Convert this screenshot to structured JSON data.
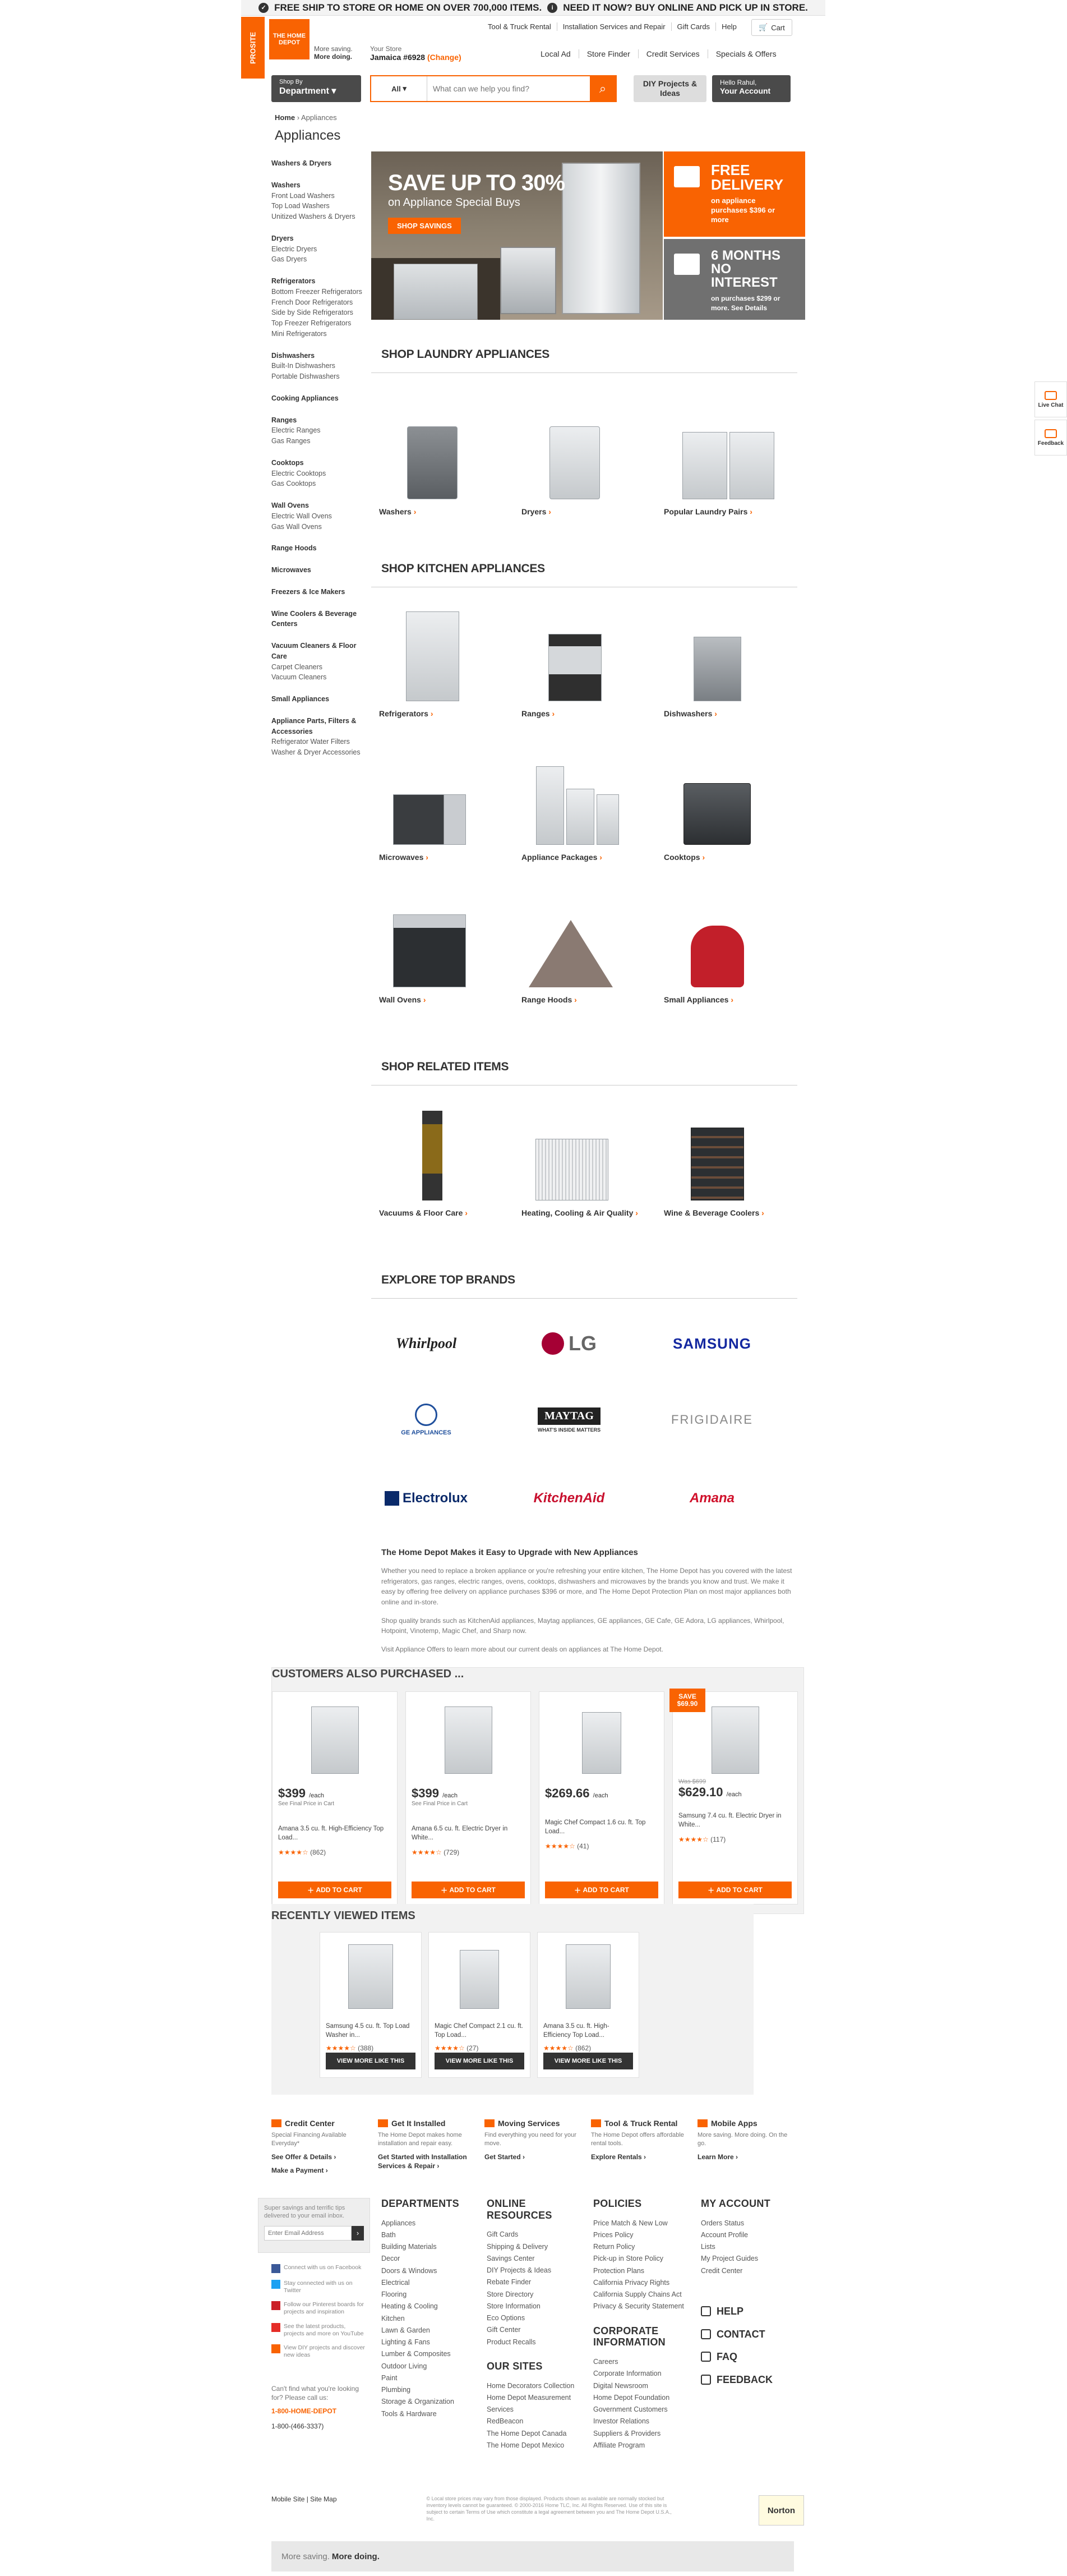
{
  "banner": {
    "left": "FREE SHIP TO STORE OR HOME ON OVER 700,000 ITEMS.",
    "right": "NEED IT NOW? BUY ONLINE AND PICK UP IN STORE."
  },
  "header": {
    "prosite": "PROSITE",
    "logo": "THE HOME DEPOT",
    "tagline1": "More saving.",
    "tagline2": "More doing.",
    "toplinks": [
      "Tool & Truck Rental",
      "Installation Services and Repair",
      "Gift Cards",
      "Help"
    ],
    "cart": "Cart",
    "store_label": "Your Store",
    "store_name": "Jamaica #6928",
    "store_change": "(Change)",
    "mainlinks": [
      "Local Ad",
      "Store Finder",
      "Credit Services",
      "Specials & Offers"
    ],
    "dept_top": "Shop By",
    "dept_bottom": "Department",
    "search_all": "All",
    "search_placeholder": "What can we help you find?",
    "diy": "DIY Projects & Ideas",
    "acct_top": "Hello Rahul,",
    "acct_bottom": "Your Account"
  },
  "breadcrumb": {
    "home": "Home",
    "current": "Appliances"
  },
  "page_title": "Appliances",
  "sidebar": [
    {
      "h": "Washers & Dryers",
      "items": []
    },
    {
      "h": "Washers",
      "items": [
        "Front Load Washers",
        "Top Load Washers",
        "Unitized Washers & Dryers"
      ]
    },
    {
      "h": "Dryers",
      "items": [
        "Electric Dryers",
        "Gas Dryers"
      ]
    },
    {
      "h": "Refrigerators",
      "items": [
        "Bottom Freezer Refrigerators",
        "French Door Refrigerators",
        "Side by Side Refrigerators",
        "Top Freezer Refrigerators",
        "Mini Refrigerators"
      ]
    },
    {
      "h": "Dishwashers",
      "items": [
        "Built-In Dishwashers",
        "Portable Dishwashers"
      ]
    },
    {
      "h": "Cooking Appliances",
      "items": []
    },
    {
      "h": "Ranges",
      "items": [
        "Electric Ranges",
        "Gas Ranges"
      ]
    },
    {
      "h": "Cooktops",
      "items": [
        "Electric Cooktops",
        "Gas Cooktops"
      ]
    },
    {
      "h": "Wall Ovens",
      "items": [
        "Electric Wall Ovens",
        "Gas Wall Ovens"
      ]
    },
    {
      "h": "Range Hoods",
      "items": []
    },
    {
      "h": "Microwaves",
      "items": []
    },
    {
      "h": "Freezers & Ice Makers",
      "items": []
    },
    {
      "h": "Wine Coolers & Beverage Centers",
      "items": []
    },
    {
      "h": "Vacuum Cleaners & Floor Care",
      "items": [
        "Carpet Cleaners",
        "Vacuum Cleaners"
      ]
    },
    {
      "h": "Small Appliances",
      "items": []
    },
    {
      "h": "Appliance Parts, Filters & Accessories",
      "items": [
        "Refrigerator Water Filters",
        "Washer & Dryer Accessories"
      ]
    }
  ],
  "hero": {
    "title": "SAVE UP TO 30%",
    "subtitle": "on Appliance Special Buys",
    "button": "SHOP SAVINGS"
  },
  "promo1": {
    "title1": "FREE",
    "title2": "DELIVERY",
    "text": "on appliance purchases $396 or more"
  },
  "promo2": {
    "title1": "6 MONTHS",
    "title2": "NO INTEREST",
    "text": "on purchases $299 or more. See Details"
  },
  "sections": {
    "laundry": "SHOP LAUNDRY APPLIANCES",
    "kitchen": "SHOP KITCHEN APPLIANCES",
    "related": "SHOP RELATED ITEMS",
    "brands": "EXPLORE TOP BRANDS"
  },
  "laundry": [
    "Washers",
    "Dryers",
    "Popular Laundry Pairs"
  ],
  "kitchen": [
    "Refrigerators",
    "Ranges",
    "Dishwashers",
    "Microwaves",
    "Appliance Packages",
    "Cooktops",
    "Wall Ovens",
    "Range Hoods",
    "Small Appliances"
  ],
  "related": [
    "Vacuums & Floor Care",
    "Heating, Cooling & Air Quality",
    "Wine & Beverage Coolers"
  ],
  "brands": [
    "Whirlpool",
    "LG",
    "SAMSUNG",
    "GE APPLIANCES",
    "MAYTAG",
    "FRIGIDAIRE",
    "Electrolux",
    "KitchenAid",
    "Amana"
  ],
  "brand_sub": {
    "maytag": "WHAT'S INSIDE MATTERS"
  },
  "seo": {
    "title": "The Home Depot Makes it Easy to Upgrade with New Appliances",
    "p1": "Whether you need to replace a broken appliance or you're refreshing your entire kitchen, The Home Depot has you covered with the latest refrigerators, gas ranges, electric ranges, ovens, cooktops, dishwashers and microwaves by the brands you know and trust. We make it easy by offering free delivery on appliance purchases $396 or more, and The Home Depot Protection Plan on most major appliances both online and in-store.",
    "p2": "Shop quality brands such as KitchenAid appliances, Maytag appliances, GE appliances, GE Cafe, GE Adora, LG appliances, Whirlpool, Hotpoint, Vinotemp, Magic Chef, and Sharp now.",
    "p3": "Visit Appliance Offers to learn more about our current deals on appliances at The Home Depot."
  },
  "also": {
    "title": "CUSTOMERS ALSO PURCHASED ...",
    "add": "ADD TO CART",
    "items": [
      {
        "price": "$399",
        "each": "/each",
        "sub": "See Final Price in Cart",
        "name": "Amana 3.5 cu. ft. High-Efficiency Top Load...",
        "stars": "★★★★☆",
        "count": "(862)"
      },
      {
        "price": "$399",
        "each": "/each",
        "sub": "See Final Price in Cart",
        "name": "Amana 6.5 cu. ft. Electric Dryer in White...",
        "stars": "★★★★☆",
        "count": "(729)"
      },
      {
        "price": "$269.66",
        "each": "/each",
        "sub": "",
        "name": "Magic Chef Compact 1.6 cu. ft. Top Load...",
        "stars": "★★★★☆",
        "count": "(41)"
      },
      {
        "price": "$629.10",
        "each": "/each",
        "sub": "",
        "was": "Was $699",
        "save1": "SAVE",
        "save2": "$69.90",
        "name": "Samsung 7.4 cu. ft. Electric Dryer in White...",
        "stars": "★★★★☆",
        "count": "(117)"
      }
    ]
  },
  "recent": {
    "title": "RECENTLY VIEWED ITEMS",
    "button": "VIEW MORE LIKE THIS",
    "items": [
      {
        "name": "Samsung 4.5 cu. ft. Top Load Washer in...",
        "stars": "★★★★☆",
        "count": "(388)"
      },
      {
        "name": "Magic Chef Compact 2.1 cu. ft. Top Load...",
        "stars": "★★★★☆",
        "count": "(27)"
      },
      {
        "name": "Amana 3.5 cu. ft. High-Efficiency Top Load...",
        "stars": "★★★★☆",
        "count": "(862)"
      }
    ]
  },
  "services": [
    {
      "h": "Credit Center",
      "p": "Special Financing Available Everyday*",
      "l1": "See Offer & Details",
      "l2": "Make a Payment"
    },
    {
      "h": "Get It Installed",
      "p": "The Home Depot makes home installation and repair easy.",
      "l1": "Get Started with Installation Services & Repair",
      "l2": ""
    },
    {
      "h": "Moving Services",
      "p": "Find everything you need for your move.",
      "l1": "Get Started",
      "l2": ""
    },
    {
      "h": "Tool & Truck Rental",
      "p": "The Home Depot offers affordable rental tools.",
      "l1": "Explore Rentals",
      "l2": ""
    },
    {
      "h": "Mobile Apps",
      "p": "More saving. More doing. On the go.",
      "l1": "Learn More",
      "l2": ""
    }
  ],
  "newsletter": {
    "text": "Super savings and terrific tips delivered to your email inbox.",
    "placeholder": "Enter Email Address"
  },
  "social": [
    "Connect with us on Facebook",
    "Stay connected with us on Twitter",
    "Follow our Pinterest boards for projects and inspiration",
    "See the latest products, projects and more on YouTube",
    "View DIY projects and discover new ideas"
  ],
  "callus": {
    "text": "Can't find what you're looking for? Please call us:",
    "phone": "1-800-HOME-DEPOT",
    "phone2": "1-800-(466-3337)"
  },
  "footer": {
    "departments_h": "DEPARTMENTS",
    "departments": [
      "Appliances",
      "Bath",
      "Building Materials",
      "Decor",
      "Doors & Windows",
      "Electrical",
      "Flooring",
      "Heating & Cooling",
      "Kitchen",
      "Lawn & Garden",
      "Lighting & Fans",
      "Lumber & Composites",
      "Outdoor Living",
      "Paint",
      "Plumbing",
      "Storage & Organization",
      "Tools & Hardware"
    ],
    "online_h": "ONLINE RESOURCES",
    "online": [
      "Gift Cards",
      "Shipping & Delivery",
      "Savings Center",
      "DIY Projects & Ideas",
      "Rebate Finder",
      "Store Directory",
      "Store Information",
      "Eco Options",
      "Gift Center",
      "Product Recalls"
    ],
    "oursites_h": "OUR SITES",
    "oursites": [
      "Home Decorators Collection",
      "Home Depot Measurement Services",
      "RedBeacon",
      "The Home Depot Canada",
      "The Home Depot Mexico"
    ],
    "policies_h": "POLICIES",
    "policies": [
      "Price Match & New Low Prices Policy",
      "Return Policy",
      "Pick-up in Store Policy",
      "Protection Plans",
      "California Privacy Rights",
      "California Supply Chains Act",
      "Privacy & Security Statement"
    ],
    "corporate_h": "CORPORATE INFORMATION",
    "corporate": [
      "Careers",
      "Corporate Information",
      "Digital Newsroom",
      "Home Depot Foundation",
      "Government Customers",
      "Investor Relations",
      "Suppliers & Providers",
      "Affiliate Program"
    ],
    "account_h": "MY ACCOUNT",
    "account": [
      "Orders Status",
      "Account Profile",
      "Lists",
      "My Project Guides",
      "Credit Center"
    ],
    "help": [
      "HELP",
      "CONTACT",
      "FAQ",
      "FEEDBACK"
    ]
  },
  "bottom": {
    "mobile": "Mobile Site",
    "sitemap": "Site Map",
    "legal": "© Local store prices may vary from those displayed. Products shown as available are normally stocked but inventory levels cannot be guaranteed. © 2000-2016 Home TLC, Inc. All Rights Reserved. Use of this site is subject to certain Terms of Use which constitute a legal agreement between you and The Home Depot U.S.A., Inc.",
    "norton": "Norton",
    "bar1": "More saving.",
    "bar2": "More doing."
  },
  "side": {
    "chat": "Live Chat",
    "feedback": "Feedback"
  }
}
